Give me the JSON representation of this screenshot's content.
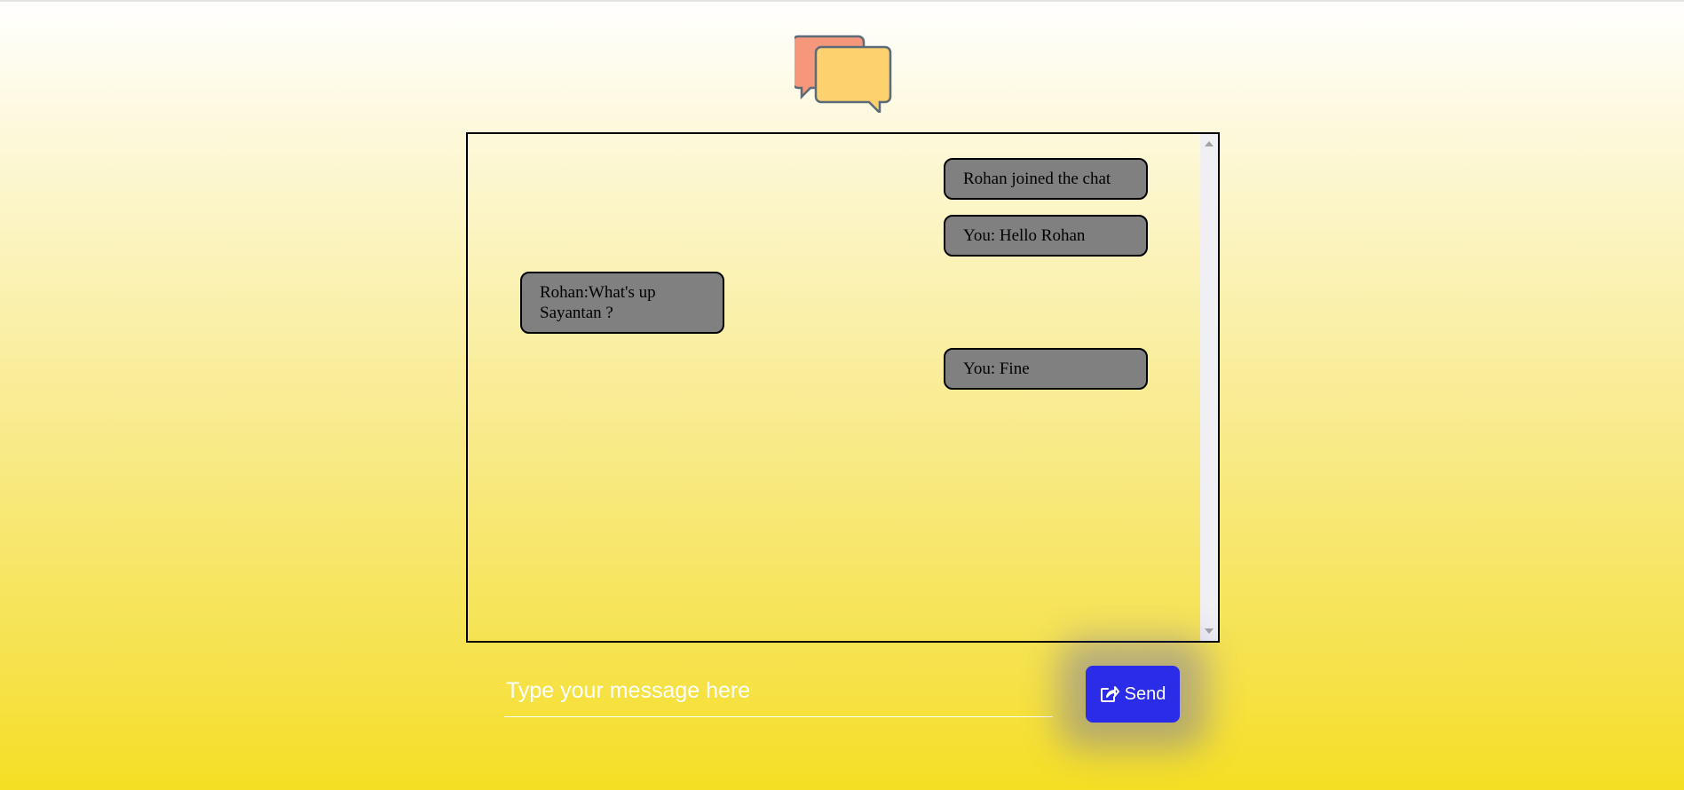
{
  "messages": [
    {
      "text": "Rohan joined the chat",
      "side": "right"
    },
    {
      "text": "You: Hello Rohan",
      "side": "right"
    },
    {
      "text": "Rohan:What's up Sayantan ?",
      "side": "left"
    },
    {
      "text": "You: Fine",
      "side": "right"
    }
  ],
  "composer": {
    "placeholder": "Type your message here",
    "value": ""
  },
  "send": {
    "label": "Send",
    "icon": "share-icon"
  },
  "colors": {
    "bubble": "#808080",
    "send_button": "#2b2ce8",
    "logo_back_bubble": "#f5977a",
    "logo_front_bubble": "#fed16f"
  }
}
